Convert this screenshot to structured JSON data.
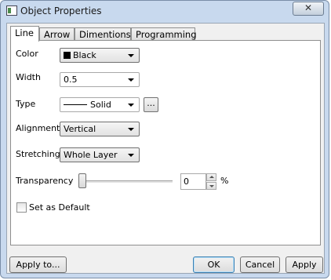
{
  "window": {
    "title": "Object Properties",
    "close_glyph": "✕",
    "icon": "app-window-icon"
  },
  "tabs": [
    {
      "label": "Line",
      "active": true
    },
    {
      "label": "Arrow",
      "active": false
    },
    {
      "label": "Dimentions",
      "active": false
    },
    {
      "label": "Programming",
      "active": false
    }
  ],
  "form": {
    "color": {
      "label": "Color",
      "value": "Black",
      "swatch": "#000000"
    },
    "width": {
      "label": "Width",
      "value": "0.5"
    },
    "type": {
      "label": "Type",
      "value": "Solid",
      "button": "..."
    },
    "alignment": {
      "label": "Alignment",
      "value": "Vertical"
    },
    "stretching": {
      "label": "Stretching",
      "value": "Whole Layer"
    },
    "transparency": {
      "label": "Transparency",
      "value": "0",
      "unit": "%",
      "level": 0
    },
    "default_checkbox": {
      "label": "Set as Default",
      "checked": false
    }
  },
  "footer": {
    "apply_to": "Apply to...",
    "ok": "OK",
    "cancel": "Cancel",
    "apply": "Apply"
  }
}
